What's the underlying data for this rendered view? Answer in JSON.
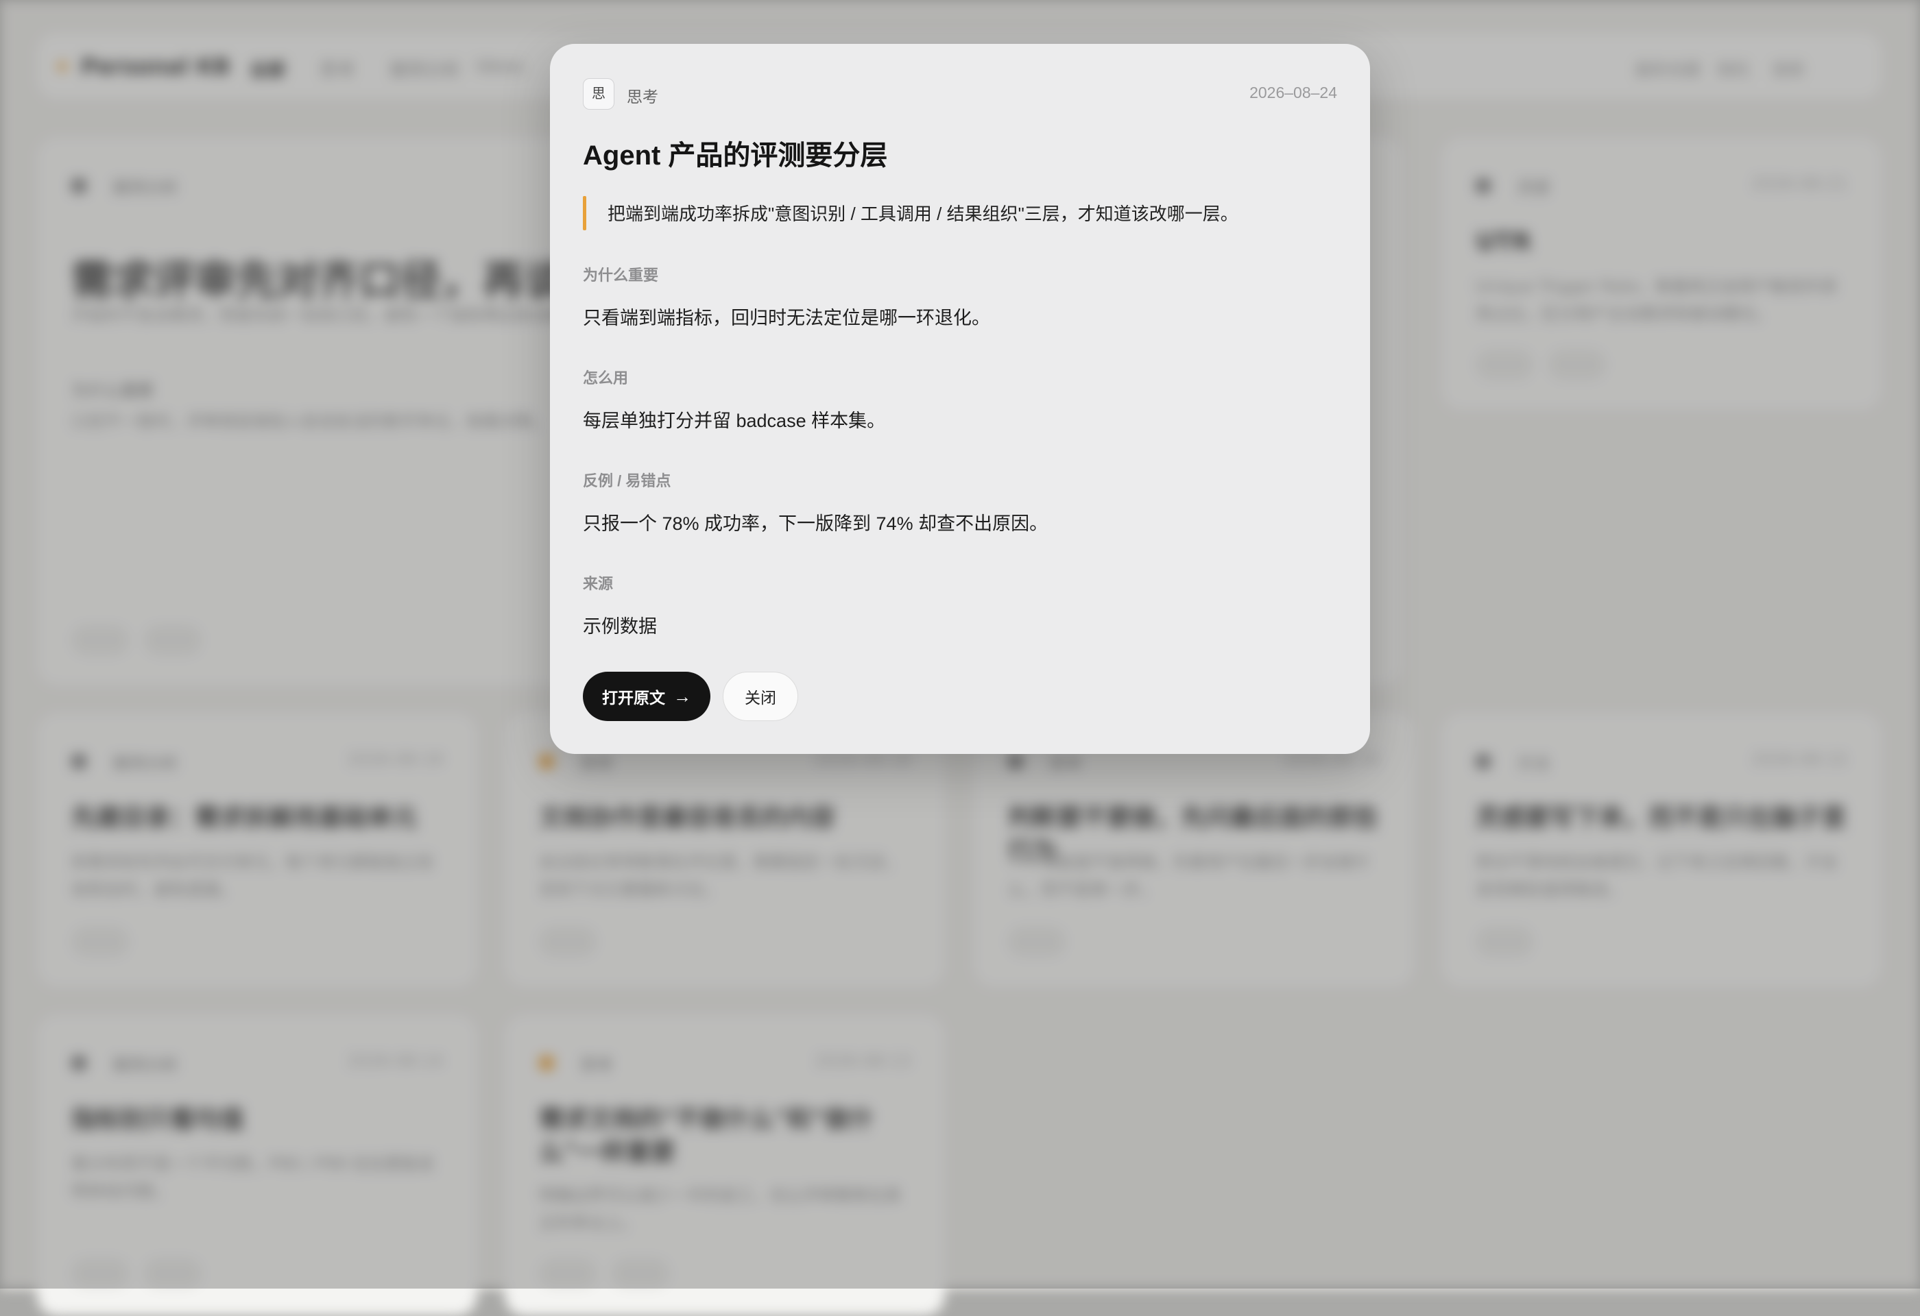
{
  "app": {
    "logo": "Personal KB",
    "nav_tabs": [
      "全部",
      "思考",
      "案例分析",
      "Ideas"
    ],
    "nav_right": [
      "最新收藏",
      "随机",
      "搜索"
    ]
  },
  "background_cards": [
    {
      "category": "案例分析",
      "title": "需求评审先对齐口径，再谈方案",
      "excerpt": "开始时不急谈需求，而是先统一验收口径，避免一个指标两边各自解读。",
      "section_label": "为什么重要",
      "section_text": "口径不一致时，评审很容易陷入各说各话的数字争论，拖慢决策。",
      "tags": [
        "评审",
        "口径"
      ]
    },
    {
      "category": "灵感",
      "date": "2026-08-21",
      "title": "UTR",
      "excerpt": "Unique Trigger Rate，衡量真正由用户触发的调用占比，区分用户主动需求和被动曝光。",
      "tags": [
        "指标",
        "定义"
      ]
    },
    {
      "category": "案例分析",
      "date": "2026-08-19",
      "title": "先建目录：需求拆解用基础单元",
      "excerpt": "拆需求前先列出可交付单元，每个单元都能独立验收和估时，避免遗漏。",
      "tags": [
        "拆解"
      ]
    },
    {
      "category": "思考",
      "date": "2026-08-18",
      "title": "文档协作里最容易丢的内容",
      "excerpt": "会议结论常常散落在评论里，需要固定一处沉淀，否则下次又要重新讨论。",
      "tags": [
        "协作"
      ]
    },
    {
      "category": "思考",
      "date": "2026-08-16",
      "title": "判断要不要做，先问最后面的那些行为",
      "excerpt": "一个功能值不值得做，先看用户在最后一步会做什么，而不是第一步。",
      "tags": [
        "判断"
      ]
    },
    {
      "category": "方法",
      "date": "2026-08-15",
      "title": "灵感要写下来，而不是只在脑子里",
      "excerpt": "想法不落地就会被遗忘，记下来之后再回看，才会发现哪些值得推进。",
      "tags": [
        "习惯"
      ]
    },
    {
      "category": "案例分析",
      "date": "2026-08-14",
      "title": "指标别只看均值",
      "excerpt": "看分布而不是一个平均数，P90 / P99 往往更能说明体验问题。",
      "tags": [
        "指标",
        "分布"
      ]
    },
    {
      "category": "思考",
      "date": "2026-08-13",
      "title": "需求文档的\"不做什么\"和\"做什么\"一样重要",
      "excerpt": "明确边界可以减少一半的返工，也让评审聚焦在真正的争议上。",
      "tags": [
        "文档",
        "边界"
      ]
    }
  ],
  "modal": {
    "category_badge": "思",
    "category": "思考",
    "date": "2026–08–24",
    "title": "Agent 产品的评测要分层",
    "quote": "把端到端成功率拆成\"意图识别 / 工具调用 / 结果组织\"三层，才知道该改哪一层。",
    "sections": [
      {
        "label": "为什么重要",
        "text": "只看端到端指标，回归时无法定位是哪一环退化。"
      },
      {
        "label": "怎么用",
        "text": "每层单独打分并留 badcase 样本集。"
      },
      {
        "label": "反例 / 易错点",
        "text": "只报一个 78% 成功率，下一版降到 74% 却查不出原因。"
      },
      {
        "label": "来源",
        "text": "示例数据"
      }
    ],
    "open_button": "打开原文",
    "open_arrow": "→",
    "close_button": "关闭"
  }
}
